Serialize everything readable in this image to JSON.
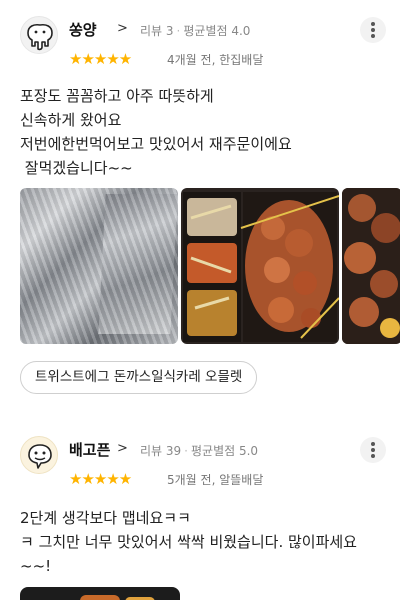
{
  "reviews": [
    {
      "name": "쏭양",
      "review_count_label": "리뷰 3",
      "avg_label": "평균별점 4.0",
      "rating": 5,
      "stars": "★★★★★",
      "when": "4개월 전, 한집배달",
      "avatar_icon": "elephant-icon",
      "body": "포장도 꼼꼼하고 아주 따뜻하게\n신속하게 왔어요\n저번에한번먹어보고 맛있어서 재주문이에요\n 잘먹겠습니다~~",
      "photo_count_visible": 3,
      "menu_tag": "트위스트에그 돈까스일식카레 오믈렛"
    },
    {
      "name": "배고픈",
      "review_count_label": "리뷰 39",
      "avg_label": "평균별점 5.0",
      "rating": 5,
      "stars": "★★★★★",
      "when": "5개월 전, 알뜰배달",
      "avatar_icon": "hungry-face-icon",
      "body": "2단계 생각보다 맵네요ㅋㅋ\nㅋ 그치만 너무 맛있어서 싹싹 비웠습니다. 많이파세요\n~~!"
    }
  ],
  "colors": {
    "star": "#ffb400",
    "text": "#222222",
    "meta": "#888888"
  }
}
